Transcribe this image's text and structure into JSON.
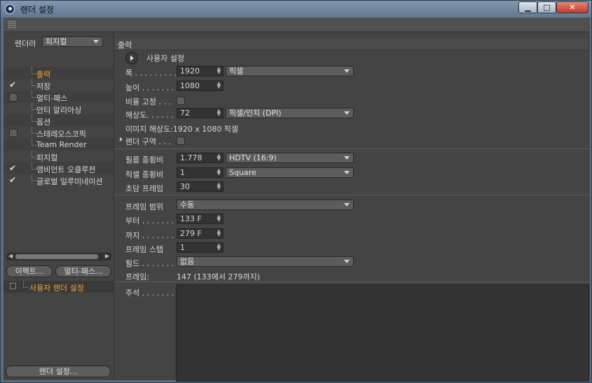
{
  "window": {
    "title": "렌더 설정",
    "min_glyph": "▁",
    "max_glyph": "□",
    "close_glyph": "✕"
  },
  "left": {
    "renderer_label": "렌더러",
    "renderer_value": "피지컬",
    "tree": [
      {
        "label": "출력",
        "checked": null,
        "selected": true
      },
      {
        "label": "저장",
        "checked": true,
        "selected": false
      },
      {
        "label": "멀티-패스",
        "checked": false,
        "selected": false
      },
      {
        "label": "안티 알리아싱",
        "checked": null,
        "selected": false
      },
      {
        "label": "옵션",
        "checked": null,
        "selected": false
      },
      {
        "label": "스테레오스코픽",
        "checked": false,
        "selected": false
      },
      {
        "label": "Team Render",
        "checked": null,
        "selected": false
      },
      {
        "label": "피지컬",
        "checked": null,
        "selected": false
      },
      {
        "label": "앰비언트 오클루전",
        "checked": true,
        "selected": false
      },
      {
        "label": "글로벌 일루미네이션",
        "checked": true,
        "selected": false
      }
    ],
    "effect_button": "이펙트...",
    "multipass_button": "멀티-패스...",
    "custom_render_setting": "사용자 렌더 설정",
    "render_settings_button": "렌더 설정..."
  },
  "main": {
    "section_title": "출력",
    "preset_label": "사용자 설정",
    "width_label": "폭 . . . . . . . . . .",
    "width_value": "1920",
    "width_unit": "픽셀",
    "height_label": "높이 . . . . . . . .",
    "height_value": "1080",
    "lock_ratio_label": "비율 고정 . . .",
    "resolution_label": "해상도. . . . . .",
    "resolution_value": "72",
    "resolution_unit": "픽셀/인치 (DPI)",
    "image_resolution": "이미지 해상도:1920 x 1080 픽셀",
    "render_region_label": "렌더 구역 . . .",
    "film_aspect_label": "필름 종횡비",
    "film_aspect_value": "1.778",
    "film_aspect_preset": "HDTV (16:9)",
    "pixel_aspect_label": "픽셀 종횡비",
    "pixel_aspect_value": "1",
    "pixel_aspect_preset": "Square",
    "fps_label": "초당 프레임",
    "fps_value": "30",
    "frame_range_label": "프레임 범위",
    "frame_range_value": "수동",
    "from_label": "부터 . . . . . . .",
    "from_value": "133 F",
    "to_label": "까지 . . . . . . .",
    "to_value": "279 F",
    "frame_step_label": "프레임 스텝",
    "frame_step_value": "1",
    "field_label": "필드 . . . . . . .",
    "field_value": "없음",
    "frames_label": "프레임:",
    "frames_value": "147 (133에서 279까지)",
    "notes_label": "주석 . . . . . . ."
  }
}
